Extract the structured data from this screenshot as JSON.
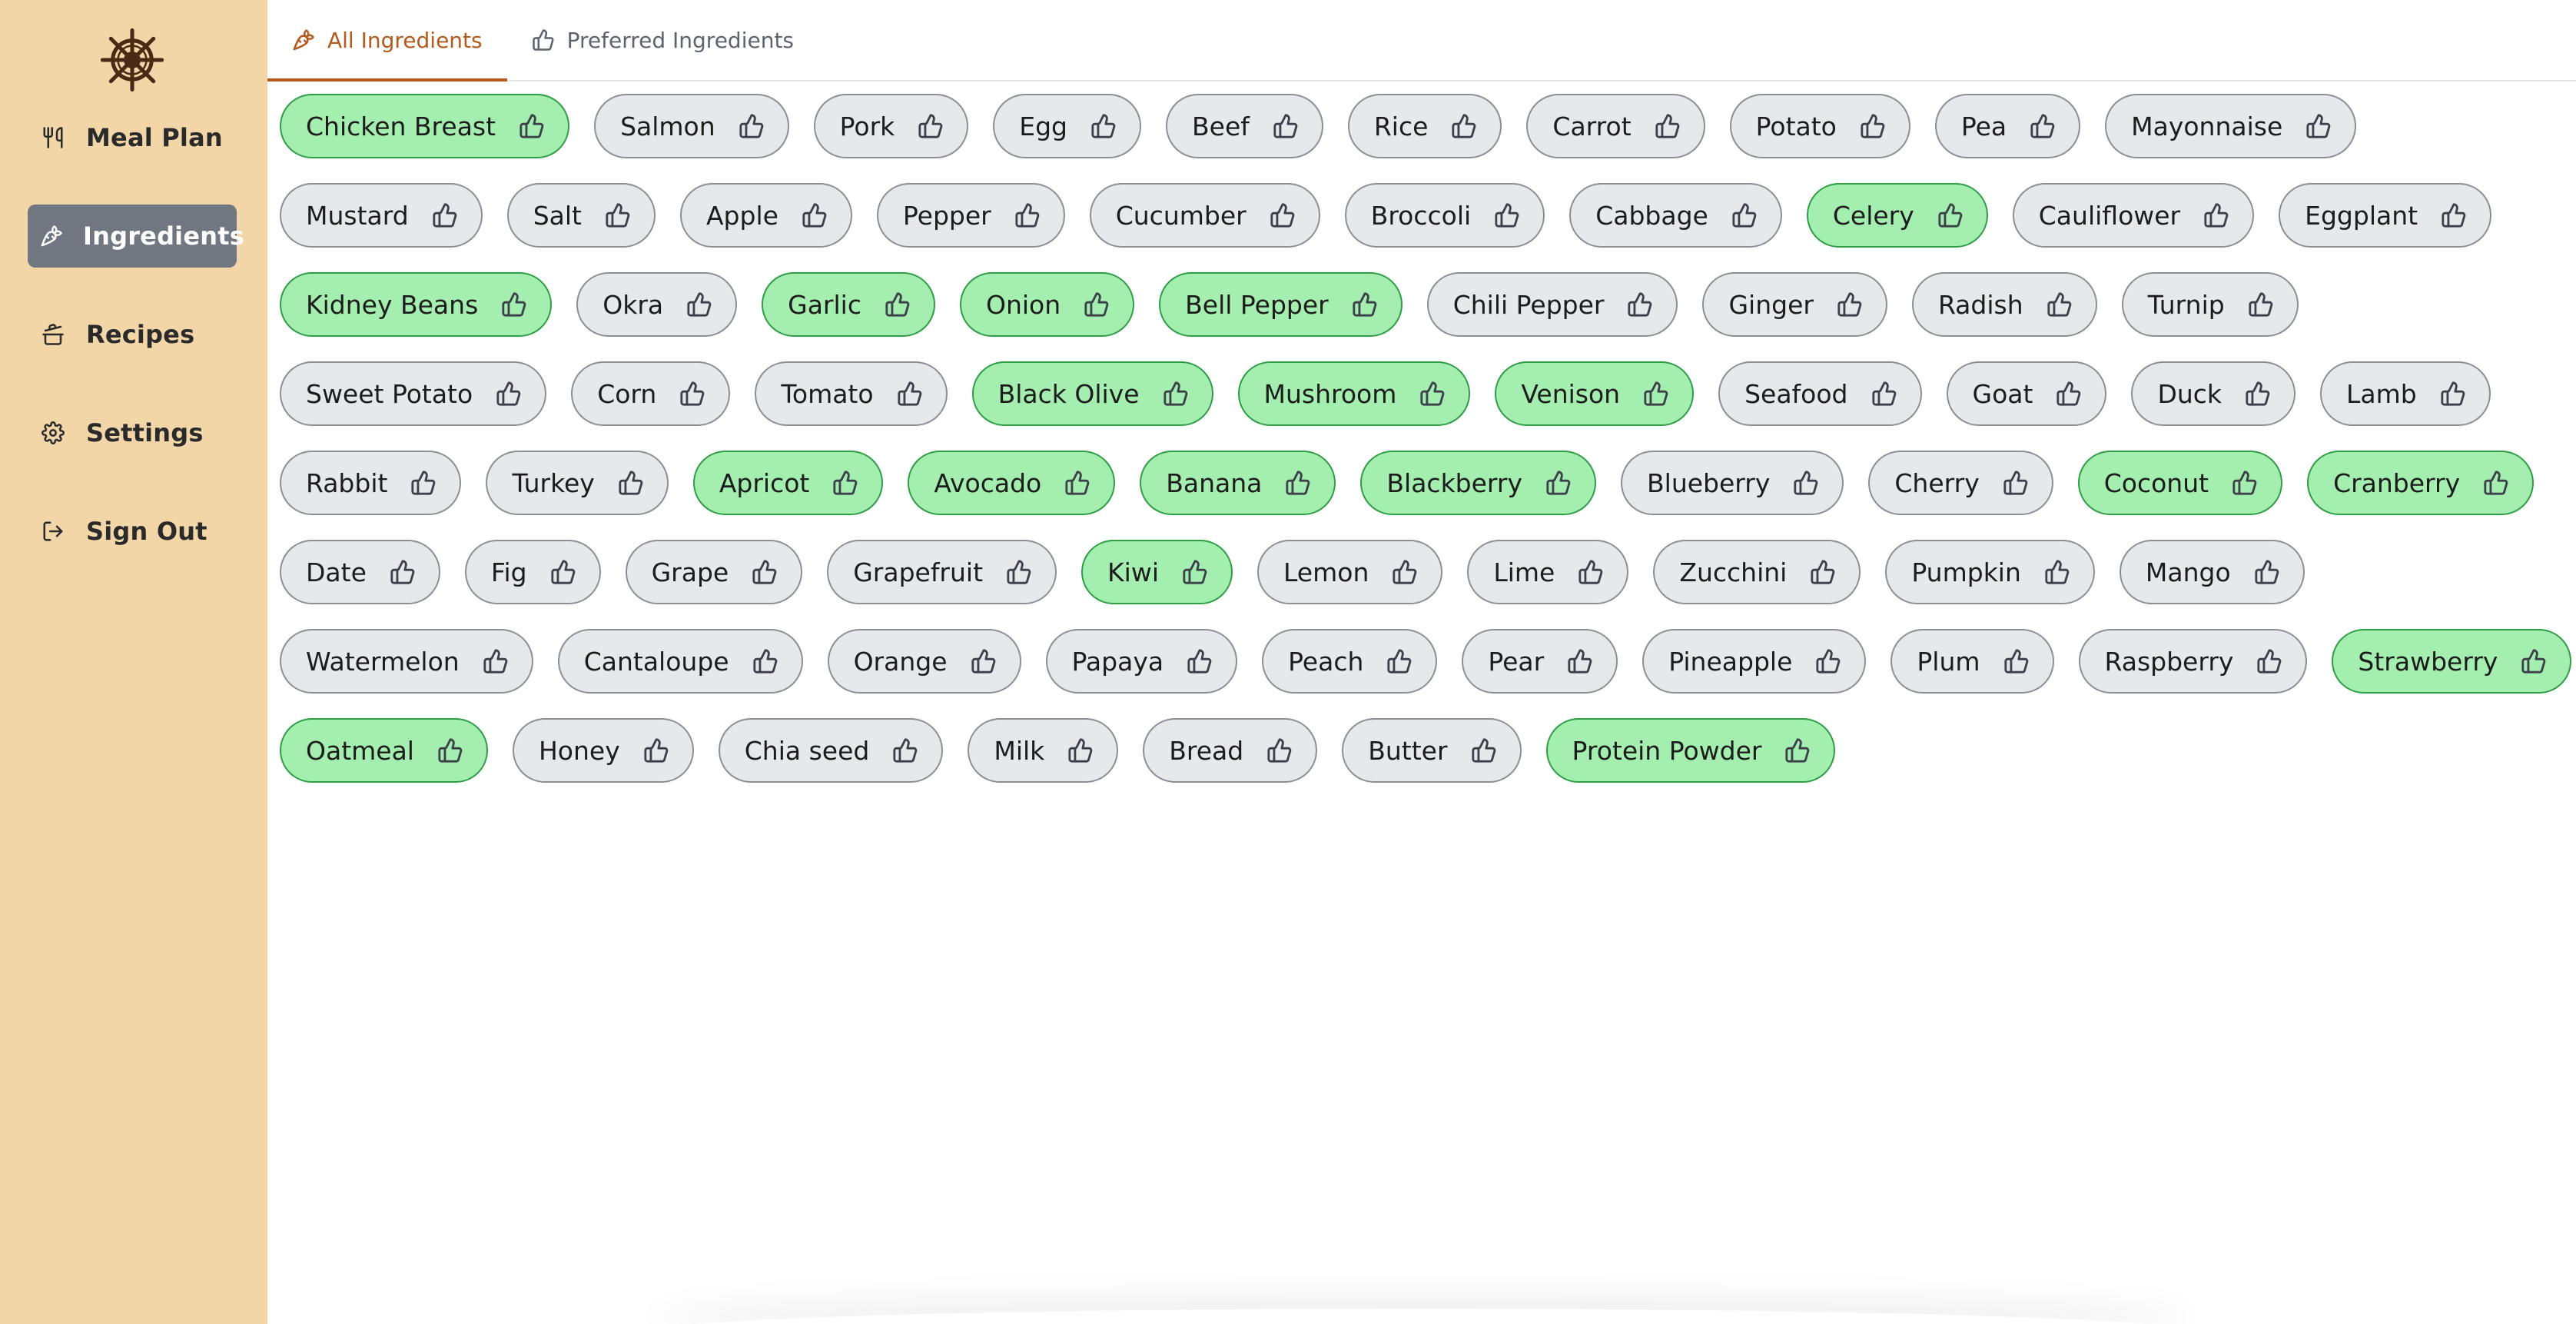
{
  "sidebar": {
    "logo_icon": "ship-wheel-icon",
    "items": [
      {
        "label": "Meal Plan",
        "icon": "utensils-icon",
        "active": false
      },
      {
        "label": "Ingredients",
        "icon": "carrot-icon",
        "active": true
      },
      {
        "label": "Recipes",
        "icon": "cooking-pot-icon",
        "active": false
      },
      {
        "label": "Settings",
        "icon": "gear-icon",
        "active": false
      },
      {
        "label": "Sign Out",
        "icon": "sign-out-icon",
        "active": false
      }
    ]
  },
  "tabs": [
    {
      "label": "All Ingredients",
      "icon": "carrot-icon",
      "active": true
    },
    {
      "label": "Preferred Ingredients",
      "icon": "thumbs-up-icon",
      "active": false
    }
  ],
  "colors": {
    "sidebar_bg": "#f2d6a8",
    "active_nav_bg": "#707781",
    "active_tab": "#b45a1c",
    "chip_bg": "#e6e8ec",
    "chip_preferred_bg": "#a4eeb0",
    "chip_preferred_border": "#2f9e47"
  },
  "ingredients": [
    {
      "name": "Chicken Breast",
      "preferred": true
    },
    {
      "name": "Salmon",
      "preferred": false
    },
    {
      "name": "Pork",
      "preferred": false
    },
    {
      "name": "Egg",
      "preferred": false
    },
    {
      "name": "Beef",
      "preferred": false
    },
    {
      "name": "Rice",
      "preferred": false
    },
    {
      "name": "Carrot",
      "preferred": false
    },
    {
      "name": "Potato",
      "preferred": false
    },
    {
      "name": "Pea",
      "preferred": false
    },
    {
      "name": "Mayonnaise",
      "preferred": false
    },
    {
      "name": "Mustard",
      "preferred": false
    },
    {
      "name": "Salt",
      "preferred": false
    },
    {
      "name": "Apple",
      "preferred": false
    },
    {
      "name": "Pepper",
      "preferred": false
    },
    {
      "name": "Cucumber",
      "preferred": false
    },
    {
      "name": "Broccoli",
      "preferred": false
    },
    {
      "name": "Cabbage",
      "preferred": false
    },
    {
      "name": "Celery",
      "preferred": true
    },
    {
      "name": "Cauliflower",
      "preferred": false
    },
    {
      "name": "Eggplant",
      "preferred": false
    },
    {
      "name": "Kidney Beans",
      "preferred": true
    },
    {
      "name": "Okra",
      "preferred": false
    },
    {
      "name": "Garlic",
      "preferred": true
    },
    {
      "name": "Onion",
      "preferred": true
    },
    {
      "name": "Bell Pepper",
      "preferred": true
    },
    {
      "name": "Chili Pepper",
      "preferred": false
    },
    {
      "name": "Ginger",
      "preferred": false
    },
    {
      "name": "Radish",
      "preferred": false
    },
    {
      "name": "Turnip",
      "preferred": false
    },
    {
      "name": "Sweet Potato",
      "preferred": false
    },
    {
      "name": "Corn",
      "preferred": false
    },
    {
      "name": "Tomato",
      "preferred": false
    },
    {
      "name": "Black Olive",
      "preferred": true
    },
    {
      "name": "Mushroom",
      "preferred": true
    },
    {
      "name": "Venison",
      "preferred": true
    },
    {
      "name": "Seafood",
      "preferred": false
    },
    {
      "name": "Goat",
      "preferred": false
    },
    {
      "name": "Duck",
      "preferred": false
    },
    {
      "name": "Lamb",
      "preferred": false
    },
    {
      "name": "Rabbit",
      "preferred": false
    },
    {
      "name": "Turkey",
      "preferred": false
    },
    {
      "name": "Apricot",
      "preferred": true
    },
    {
      "name": "Avocado",
      "preferred": true
    },
    {
      "name": "Banana",
      "preferred": true
    },
    {
      "name": "Blackberry",
      "preferred": true
    },
    {
      "name": "Blueberry",
      "preferred": false
    },
    {
      "name": "Cherry",
      "preferred": false
    },
    {
      "name": "Coconut",
      "preferred": true
    },
    {
      "name": "Cranberry",
      "preferred": true
    },
    {
      "name": "Date",
      "preferred": false
    },
    {
      "name": "Fig",
      "preferred": false
    },
    {
      "name": "Grape",
      "preferred": false
    },
    {
      "name": "Grapefruit",
      "preferred": false
    },
    {
      "name": "Kiwi",
      "preferred": true
    },
    {
      "name": "Lemon",
      "preferred": false
    },
    {
      "name": "Lime",
      "preferred": false
    },
    {
      "name": "Zucchini",
      "preferred": false
    },
    {
      "name": "Pumpkin",
      "preferred": false
    },
    {
      "name": "Mango",
      "preferred": false
    },
    {
      "name": "Watermelon",
      "preferred": false
    },
    {
      "name": "Cantaloupe",
      "preferred": false
    },
    {
      "name": "Orange",
      "preferred": false
    },
    {
      "name": "Papaya",
      "preferred": false
    },
    {
      "name": "Peach",
      "preferred": false
    },
    {
      "name": "Pear",
      "preferred": false
    },
    {
      "name": "Pineapple",
      "preferred": false
    },
    {
      "name": "Plum",
      "preferred": false
    },
    {
      "name": "Raspberry",
      "preferred": false
    },
    {
      "name": "Strawberry",
      "preferred": true
    },
    {
      "name": "Oatmeal",
      "preferred": true
    },
    {
      "name": "Honey",
      "preferred": false
    },
    {
      "name": "Chia seed",
      "preferred": false
    },
    {
      "name": "Milk",
      "preferred": false
    },
    {
      "name": "Bread",
      "preferred": false
    },
    {
      "name": "Butter",
      "preferred": false
    },
    {
      "name": "Protein Powder",
      "preferred": true
    }
  ]
}
